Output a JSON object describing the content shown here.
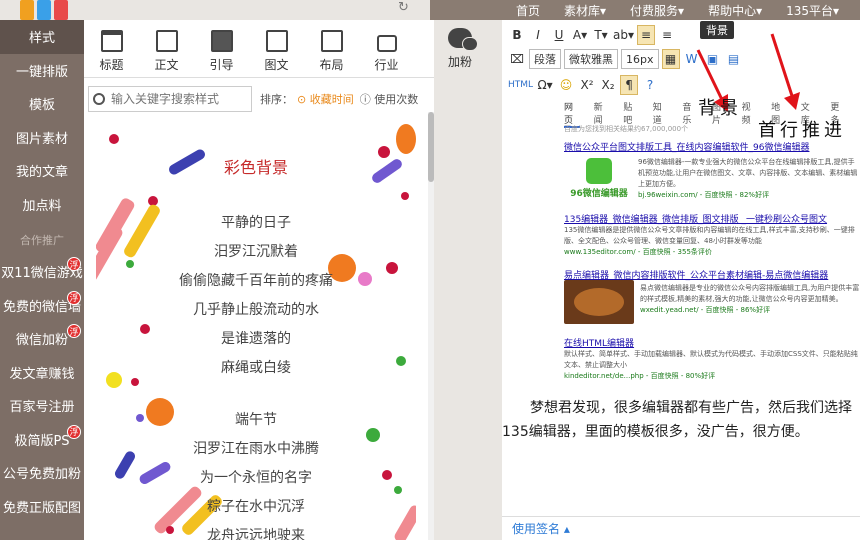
{
  "topnav": [
    "首页",
    "素材库▾",
    "付费服务▾",
    "帮助中心▾",
    "135平台▾"
  ],
  "sidebar": {
    "items": [
      {
        "label": "样式",
        "active": true
      },
      {
        "label": "一键排版"
      },
      {
        "label": "模板"
      },
      {
        "label": "图片素材"
      },
      {
        "label": "我的文章"
      },
      {
        "label": "加点料"
      }
    ],
    "partner_heading": "合作推广",
    "partners": [
      {
        "label": "双11微信游戏",
        "badge": "浮"
      },
      {
        "label": "免费的微信墙",
        "badge": "浮"
      },
      {
        "label": "微信加粉",
        "badge": "浮"
      },
      {
        "label": "发文章赚钱"
      },
      {
        "label": "百家号注册"
      },
      {
        "label": "极简版PS",
        "badge": "浮"
      },
      {
        "label": "公号免费加粉"
      },
      {
        "label": "免费正版配图"
      }
    ]
  },
  "categories": [
    "标题",
    "正文",
    "引导",
    "图文",
    "布局",
    "行业"
  ],
  "add_fans": "加粉",
  "search": {
    "placeholder": "输入关键字搜索样式",
    "sort_label": "排序：",
    "sort_time": "⊙ 收藏时间",
    "sort_use": "ⓘ 使用次数"
  },
  "preview": {
    "title": "彩色背景",
    "lines": [
      "平静的日子",
      "汨罗江沉默着",
      "偷偷隐藏千百年前的疼痛",
      "几乎静止般流动的水",
      "是谁遗落的",
      "麻绳或白绫",
      "",
      "端午节",
      "汨罗江在雨水中沸腾",
      "为一个永恒的名字",
      "粽子在水中沉浮",
      "龙舟远远地驶来"
    ]
  },
  "editor": {
    "tooltip": "背景",
    "row1": [
      "B",
      "I",
      "U",
      "A▾",
      "T▾",
      "ab▾",
      "≡",
      "≡",
      "背景"
    ],
    "row2": [
      "段落",
      "微软雅黑",
      "16px"
    ],
    "row3": [
      "HTML",
      "Ω▾",
      "☺",
      "X²",
      "X₂",
      "¶"
    ],
    "annot1": "背景",
    "annot2": "首行推进",
    "search_tabs": [
      "网页",
      "新闻",
      "贴吧",
      "知道",
      "音乐",
      "图片",
      "视频",
      "地图",
      "文库",
      "更多"
    ],
    "result_count": "百度为您找到相关结果约67,000,000个",
    "results": [
      {
        "title": "微信公众平台图文排版工具_在线内容编辑软件_96微信编辑器",
        "desc": "96微信编辑器-一款专业强大的微信公众平台在线编辑排版工具,提供手机预览功能,让用户在微信图文、文章、内容排版、文本编辑、素材编辑上更加方便。",
        "url": "bj.96weixin.com/  - 百度快照 - 82%好评"
      },
      {
        "title": "135编辑器_微信编辑器_微信排版_图文排版 _一键秒刷公众号图文",
        "desc": "135微信编辑器是提供微信公众号文章排版和内容编辑的在线工具,样式丰富,支持秒刷、一键排版、全文配色、公众号管理、微信变量回复、48小时群发等功能",
        "url": "www.135editor.com/  - 百度快照 - 355条评价"
      },
      {
        "title": "易点编辑器_微信内容排版软件_公众平台素材编辑-易点微信编辑器",
        "desc": "易点微信编辑器是专业的微信公众号内容排版编辑工具,为用户提供丰富的样式模板,精美的素材,强大的功能,让微信公众号内容更加精美。",
        "url": "wxedit.yead.net/  - 百度快照 - 86%好评"
      },
      {
        "title": "在线HTML编辑器",
        "desc": "默认样式、简单样式、手动加载编辑器、默认模式为代码模式、手动添加CSS文件、只能粘贴纯文本、禁止调整大小",
        "url": "kindeditor.net/de...php  - 百度快照 - 80%好评"
      }
    ],
    "body_text": "梦想君发现，很多编辑器都有些广告，然后我们选择135编辑器，里面的模板很多，没广告，很方便。",
    "signature": "使用签名 ▴"
  }
}
